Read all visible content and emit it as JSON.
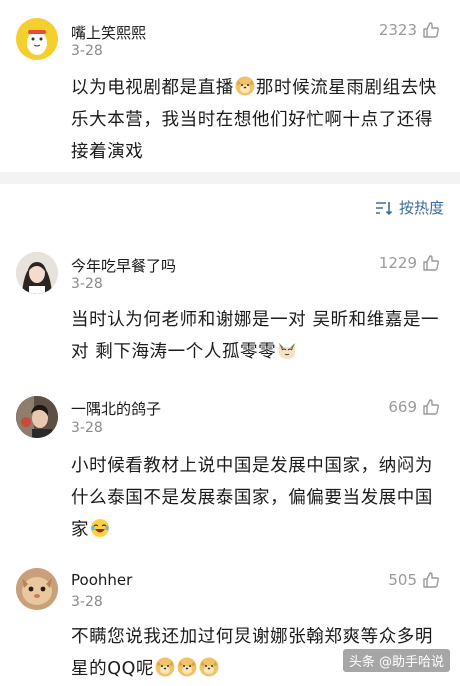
{
  "comments": [
    {
      "username": "嘴上笑熙熙",
      "date": "3-28",
      "likes": "2323",
      "text_parts": [
        "以为电视剧都是直播",
        "那时候流星雨剧组去快乐大本营，我当时在想他们好忙啊十点了还得接着演戏"
      ],
      "emojis": [
        "doge-emoji"
      ]
    },
    {
      "username": "今年吃早餐了吗",
      "date": "3-28",
      "likes": "1229",
      "text_parts": [
        "当时认为何老师和谢娜是一对 吴昕和维嘉是一对 剩下海涛一个人孤零零"
      ],
      "emojis": [
        "cat-emoji"
      ]
    },
    {
      "username": "一隅北的鸽子",
      "date": "3-28",
      "likes": "669",
      "text_parts": [
        "小时候看教材上说中国是发展中国家，纳闷为什么泰国不是发展泰国家，偏偏要当发展中国家"
      ],
      "emojis": [
        "laugh-cry-emoji"
      ]
    },
    {
      "username": "Poohher",
      "date": "3-28",
      "likes": "505",
      "text_parts": [
        "不瞒您说我还加过何炅谢娜张翰郑爽等众多明星的QQ呢"
      ],
      "emojis": [
        "doge-emoji",
        "doge-emoji",
        "doge-emoji"
      ]
    }
  ],
  "sort": {
    "label": "按热度"
  },
  "watermark": "头条 @助手哈说"
}
